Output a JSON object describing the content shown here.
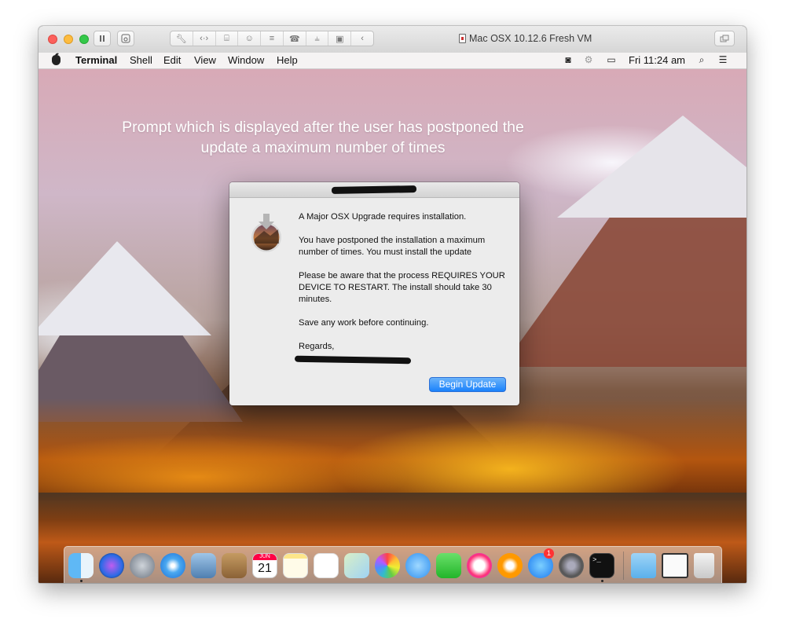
{
  "vm_window": {
    "title": "Mac OSX 10.12.6 Fresh VM"
  },
  "menubar": {
    "app_name": "Terminal",
    "items": [
      "Shell",
      "Edit",
      "View",
      "Window",
      "Help"
    ],
    "clock": "Fri 11:24 am"
  },
  "caption": {
    "line1": "Prompt which is displayed after the user has postponed the",
    "line2": "update a maximum number of times"
  },
  "dialog": {
    "paragraphs": [
      "A Major OSX Upgrade requires installation.",
      "You have postponed the installation a maximum number of times. You must install the update",
      "Please be aware that the process REQUIRES YOUR DEVICE TO RESTART. The install should take 30 minutes.",
      "Save any work before continuing.",
      "Regards,"
    ],
    "button_label": "Begin Update"
  },
  "dock": {
    "app_store_badge": "1",
    "calendar_month": "JUN",
    "calendar_day": "21",
    "icons": [
      "finder-icon",
      "siri-icon",
      "launchpad-icon",
      "safari-icon",
      "mail-icon",
      "contacts-icon",
      "calendar-icon",
      "notes-icon",
      "reminders-icon",
      "maps-icon",
      "photos-icon",
      "messages-icon",
      "facetime-icon",
      "itunes-icon",
      "ibooks-icon",
      "app-store-icon",
      "system-preferences-icon",
      "terminal-icon",
      "downloads-folder-icon",
      "screen-icon",
      "trash-icon"
    ]
  },
  "colors": {
    "accent_blue": "#1a82fb",
    "close_red": "#fc605c",
    "minimize_yellow": "#fdbc40",
    "zoom_green": "#34c84a"
  }
}
